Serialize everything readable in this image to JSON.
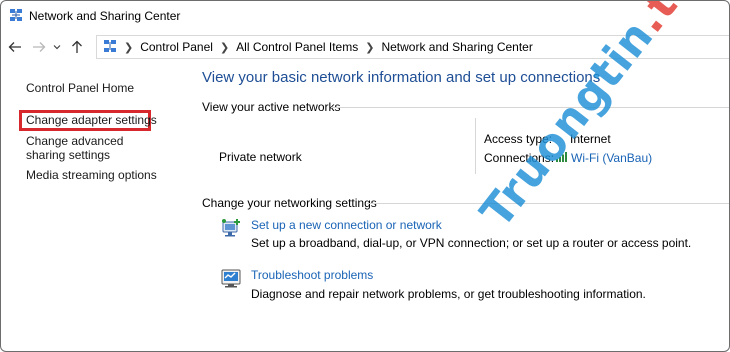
{
  "window": {
    "title": "Network and Sharing Center"
  },
  "breadcrumb": [
    "Control Panel",
    "All Control Panel Items",
    "Network and Sharing Center"
  ],
  "left_pane": {
    "items": [
      {
        "label": "Control Panel Home"
      },
      {
        "label": "Change adapter settings",
        "highlighted": true
      },
      {
        "label": "Change advanced sharing settings"
      },
      {
        "label": "Media streaming options"
      }
    ]
  },
  "main": {
    "heading": "View your basic network information and set up connections",
    "active_networks_label": "View your active networks",
    "network_name": "Private network",
    "access_type_label": "Access type:",
    "access_type_value": "Internet",
    "connections_label": "Connections:",
    "connection_value": "Wi-Fi (VanBau)",
    "change_settings_label": "Change your networking settings",
    "tasks": [
      {
        "title": "Set up a new connection or network",
        "desc": "Set up a broadband, dial-up, or VPN connection; or set up a router or access point.",
        "icon": "network-setup-icon"
      },
      {
        "title": "Troubleshoot problems",
        "desc": "Diagnose and repair network problems, or get troubleshooting information.",
        "icon": "troubleshoot-icon"
      }
    ]
  },
  "watermark": {
    "part1": "Truongtin",
    "part2": ".top"
  },
  "colors": {
    "heading_blue": "#1e4e95",
    "link_blue": "#1a64b6",
    "highlight_red": "#d7282e",
    "watermark_blue": "#1e8fd6",
    "watermark_red": "#e2392f"
  }
}
